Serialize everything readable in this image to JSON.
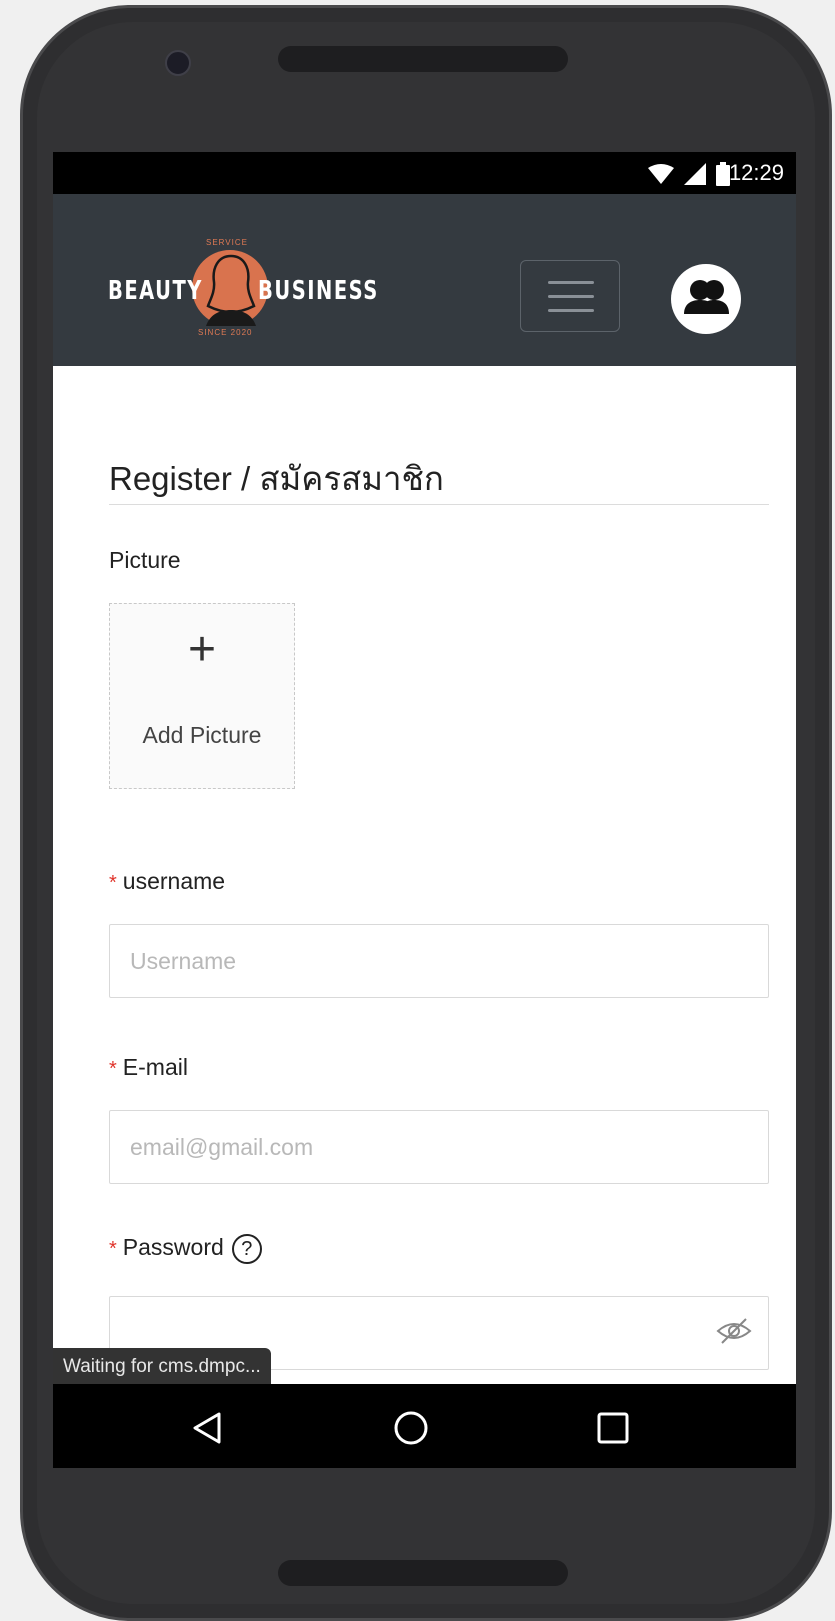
{
  "status_bar": {
    "time": "12:29"
  },
  "brand": {
    "left": "BEAUTY",
    "right": "BUSINESS",
    "top_small": "SERVICE",
    "bottom_small": "SINCE 2020",
    "accent": "#d9734e"
  },
  "header": {
    "menu_icon": "hamburger-menu-icon",
    "user_icon": "users-icon"
  },
  "form": {
    "title": "Register / สมัครสมาชิก",
    "picture_label": "Picture",
    "add_picture": "Add Picture",
    "required_mark": "*",
    "username_label": "username",
    "username_placeholder": "Username",
    "email_label": "E-mail",
    "email_placeholder": "email@gmail.com",
    "password_label": "Password",
    "password_help": "?"
  },
  "browser_status": "Waiting for cms.dmpc...",
  "nav": {
    "back": "back-triangle-icon",
    "home": "home-circle-icon",
    "recents": "recents-square-icon"
  }
}
